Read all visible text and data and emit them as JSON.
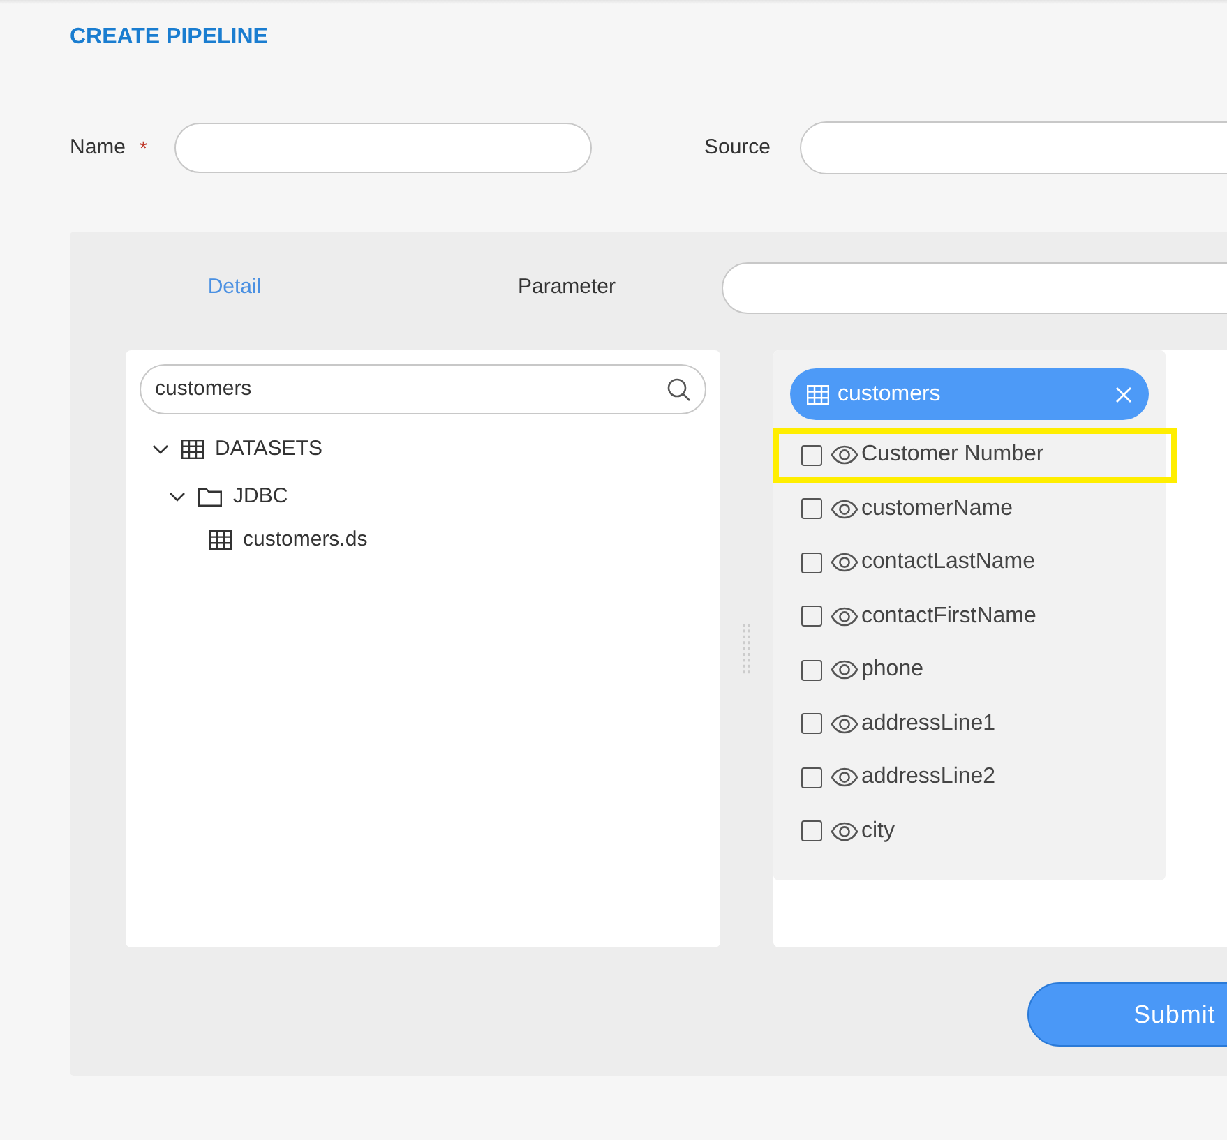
{
  "title": "CREATE PIPELINE",
  "form": {
    "name_label": "Name",
    "required_mark": "*",
    "source_label": "Source"
  },
  "tabs": [
    {
      "label": "Detail",
      "selected": true
    },
    {
      "label": "Parameter",
      "selected": false
    }
  ],
  "search": {
    "value": "customers"
  },
  "tree": [
    {
      "label": "DATASETS",
      "kind": "datasets",
      "expanded": true,
      "children": [
        {
          "label": "JDBC",
          "kind": "folder",
          "expanded": true,
          "children": [
            {
              "label": "customers.ds",
              "kind": "table"
            }
          ]
        }
      ]
    }
  ],
  "chip": {
    "label": "customers"
  },
  "fields": [
    {
      "name": "Customer Number",
      "checked": false,
      "highlighted": true
    },
    {
      "name": "customerName",
      "checked": false,
      "highlighted": false
    },
    {
      "name": "contactLastName",
      "checked": false,
      "highlighted": false
    },
    {
      "name": "contactFirstName",
      "checked": false,
      "highlighted": false
    },
    {
      "name": "phone",
      "checked": false,
      "highlighted": false
    },
    {
      "name": "addressLine1",
      "checked": false,
      "highlighted": false
    },
    {
      "name": "addressLine2",
      "checked": false,
      "highlighted": false
    },
    {
      "name": "city",
      "checked": false,
      "highlighted": false
    }
  ],
  "submit": "Submit"
}
